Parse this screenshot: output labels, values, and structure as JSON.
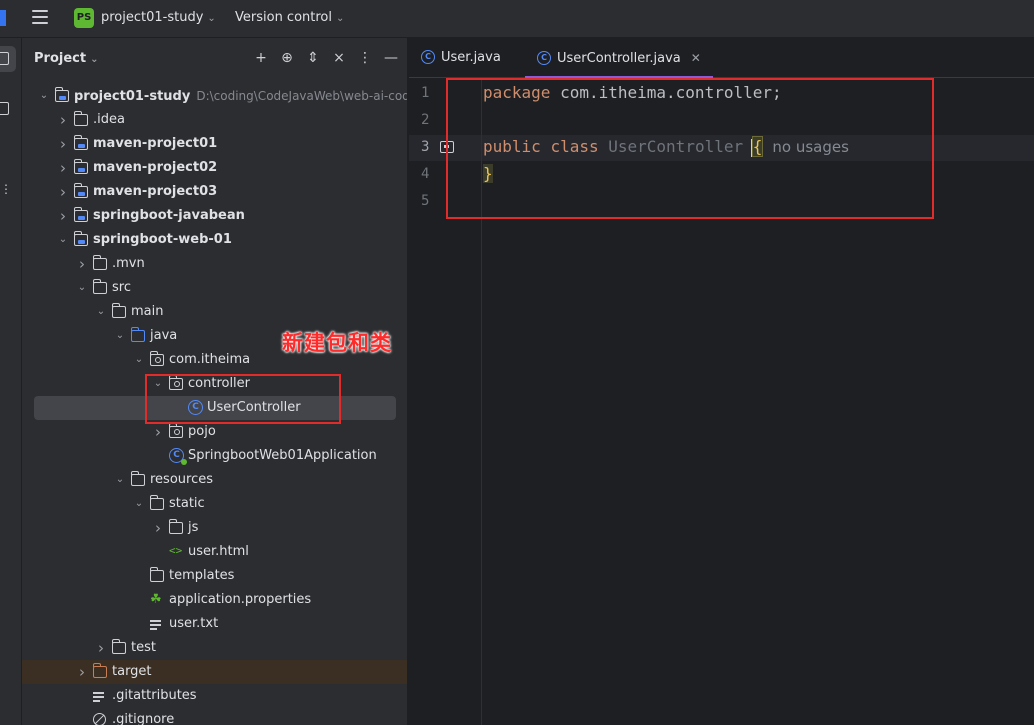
{
  "titlebar": {
    "project_badge": "PS",
    "project_name": "project01-study",
    "version_control": "Version control"
  },
  "panel": {
    "title": "Project",
    "toolbar_icons": [
      "add-icon",
      "locate-icon",
      "expand-all-icon",
      "collapse-all-icon",
      "more-icon",
      "hide-icon"
    ]
  },
  "tree": [
    {
      "label": "project01-study",
      "path": "D:\\coding\\CodeJavaWeb\\web-ai-code\\p",
      "depth": 0,
      "expanded": true,
      "icon": "module-folder",
      "bold": true
    },
    {
      "label": ".idea",
      "depth": 1,
      "expanded": false,
      "icon": "folder"
    },
    {
      "label": "maven-project01",
      "depth": 1,
      "expanded": false,
      "icon": "module-folder",
      "bold": true
    },
    {
      "label": "maven-project02",
      "depth": 1,
      "expanded": false,
      "icon": "module-folder",
      "bold": true
    },
    {
      "label": "maven-project03",
      "depth": 1,
      "expanded": false,
      "icon": "module-folder",
      "bold": true
    },
    {
      "label": "springboot-javabean",
      "depth": 1,
      "expanded": false,
      "icon": "module-folder",
      "bold": true
    },
    {
      "label": "springboot-web-01",
      "depth": 1,
      "expanded": true,
      "icon": "module-folder",
      "bold": true
    },
    {
      "label": ".mvn",
      "depth": 2,
      "expanded": false,
      "icon": "folder"
    },
    {
      "label": "src",
      "depth": 2,
      "expanded": true,
      "icon": "folder"
    },
    {
      "label": "main",
      "depth": 3,
      "expanded": true,
      "icon": "folder"
    },
    {
      "label": "java",
      "depth": 4,
      "expanded": true,
      "icon": "source-folder"
    },
    {
      "label": "com.itheima",
      "depth": 5,
      "expanded": true,
      "icon": "package"
    },
    {
      "label": "controller",
      "depth": 6,
      "expanded": true,
      "icon": "package"
    },
    {
      "label": "UserController",
      "depth": 7,
      "icon": "class",
      "selected": true
    },
    {
      "label": "pojo",
      "depth": 6,
      "expanded": false,
      "icon": "package"
    },
    {
      "label": "SpringbootWeb01Application",
      "depth": 6,
      "icon": "class-run"
    },
    {
      "label": "resources",
      "depth": 4,
      "expanded": true,
      "icon": "folder"
    },
    {
      "label": "static",
      "depth": 5,
      "expanded": true,
      "icon": "folder"
    },
    {
      "label": "js",
      "depth": 6,
      "expanded": false,
      "icon": "folder"
    },
    {
      "label": "user.html",
      "depth": 6,
      "icon": "html"
    },
    {
      "label": "templates",
      "depth": 5,
      "icon": "folder"
    },
    {
      "label": "application.properties",
      "depth": 5,
      "icon": "properties"
    },
    {
      "label": "user.txt",
      "depth": 5,
      "icon": "text"
    },
    {
      "label": "test",
      "depth": 3,
      "expanded": false,
      "icon": "folder"
    },
    {
      "label": "target",
      "depth": 2,
      "expanded": false,
      "icon": "excluded-folder",
      "highlight": true
    },
    {
      "label": ".gitattributes",
      "depth": 2,
      "icon": "text"
    },
    {
      "label": ".gitignore",
      "depth": 2,
      "icon": "ignore"
    }
  ],
  "annotation": {
    "text": "新建包和类"
  },
  "tabs": [
    {
      "label": "User.java",
      "active": false
    },
    {
      "label": "UserController.java",
      "active": true
    }
  ],
  "editor": {
    "line_numbers": [
      "1",
      "2",
      "3",
      "4",
      "5"
    ],
    "current_line": "3",
    "lines": {
      "l1_kw": "package",
      "l1_rest": " com.itheima.controller;",
      "l3_kw1": "public",
      "l3_kw2": "class",
      "l3_name": "UserController",
      "l3_brace": "{",
      "l3_hint": "no usages",
      "l4_brace": "}"
    }
  },
  "colors": {
    "accent": "#3574f0",
    "keyword": "#cf8e6d",
    "annotation_red": "#e22b2b",
    "active_tab_underline": "#8e5bd6"
  }
}
